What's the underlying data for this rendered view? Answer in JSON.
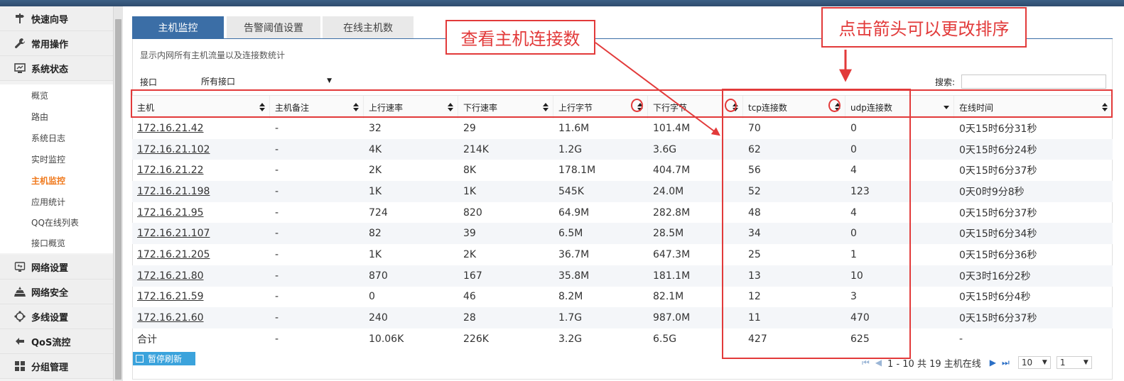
{
  "sidebar": {
    "groups_top": [
      {
        "label": "快速向导",
        "icon": "signpost-icon"
      },
      {
        "label": "常用操作",
        "icon": "wrench-icon"
      },
      {
        "label": "系统状态",
        "icon": "monitor-icon"
      }
    ],
    "items": [
      {
        "label": "概览"
      },
      {
        "label": "路由"
      },
      {
        "label": "系统日志"
      },
      {
        "label": "实时监控"
      },
      {
        "label": "主机监控",
        "active": true
      },
      {
        "label": "应用统计"
      },
      {
        "label": "QQ在线列表"
      },
      {
        "label": "接口概览"
      }
    ],
    "groups_bottom": [
      {
        "label": "网络设置",
        "icon": "network-icon"
      },
      {
        "label": "网络安全",
        "icon": "security-icon"
      },
      {
        "label": "多线设置",
        "icon": "multiline-icon"
      },
      {
        "label": "QoS流控",
        "icon": "qos-icon"
      },
      {
        "label": "分组管理",
        "icon": "group-icon"
      }
    ]
  },
  "tabs": [
    {
      "label": "主机监控",
      "active": true
    },
    {
      "label": "告警阈值设置",
      "active": false
    },
    {
      "label": "在线主机数",
      "active": false
    }
  ],
  "description": "显示内网所有主机流量以及连接数统计",
  "filter": {
    "interface_label": "接口",
    "interface_value": "所有接口",
    "search_label": "搜索:",
    "search_value": ""
  },
  "table": {
    "columns": [
      "主机",
      "主机备注",
      "上行速率",
      "下行速率",
      "上行字节",
      "下行字节",
      "tcp连接数",
      "udp连接数",
      "在线时间"
    ],
    "rows": [
      [
        "172.16.21.42",
        "-",
        "32",
        "29",
        "11.6M",
        "101.4M",
        "70",
        "0",
        "0天15时6分31秒"
      ],
      [
        "172.16.21.102",
        "-",
        "4K",
        "214K",
        "1.2G",
        "3.6G",
        "62",
        "0",
        "0天15时6分24秒"
      ],
      [
        "172.16.21.22",
        "-",
        "2K",
        "8K",
        "178.1M",
        "404.7M",
        "56",
        "4",
        "0天15时6分37秒"
      ],
      [
        "172.16.21.198",
        "-",
        "1K",
        "1K",
        "545K",
        "24.0M",
        "52",
        "123",
        "0天0时9分8秒"
      ],
      [
        "172.16.21.95",
        "-",
        "724",
        "820",
        "64.9M",
        "282.8M",
        "48",
        "4",
        "0天15时6分37秒"
      ],
      [
        "172.16.21.107",
        "-",
        "82",
        "39",
        "6.5M",
        "28.5M",
        "34",
        "0",
        "0天15时6分34秒"
      ],
      [
        "172.16.21.205",
        "-",
        "1K",
        "2K",
        "36.7M",
        "647.3M",
        "25",
        "1",
        "0天15时6分36秒"
      ],
      [
        "172.16.21.80",
        "-",
        "870",
        "167",
        "35.8M",
        "181.1M",
        "13",
        "10",
        "0天3时16分2秒"
      ],
      [
        "172.16.21.59",
        "-",
        "0",
        "46",
        "8.2M",
        "82.1M",
        "12",
        "3",
        "0天15时6分4秒"
      ],
      [
        "172.16.21.60",
        "-",
        "240",
        "28",
        "1.7G",
        "987.0M",
        "11",
        "470",
        "0天15时6分37秒"
      ]
    ],
    "total": [
      "合计",
      "-",
      "10.06K",
      "226K",
      "3.2G",
      "6.5G",
      "427",
      "625",
      "-"
    ]
  },
  "footer": {
    "pause_button": "暂停刷新",
    "pager_text": "1 - 10 共 19 主机在线",
    "page_size": "10",
    "page_number": "1"
  },
  "annotations": {
    "callout_connections": "查看主机连接数",
    "callout_sort": "点击箭头可以更改排序"
  },
  "colors": {
    "accent": "#3b6ea6",
    "active_menu": "#f07a1e",
    "annotation": "#e23a3a",
    "button": "#3ba3dc"
  }
}
